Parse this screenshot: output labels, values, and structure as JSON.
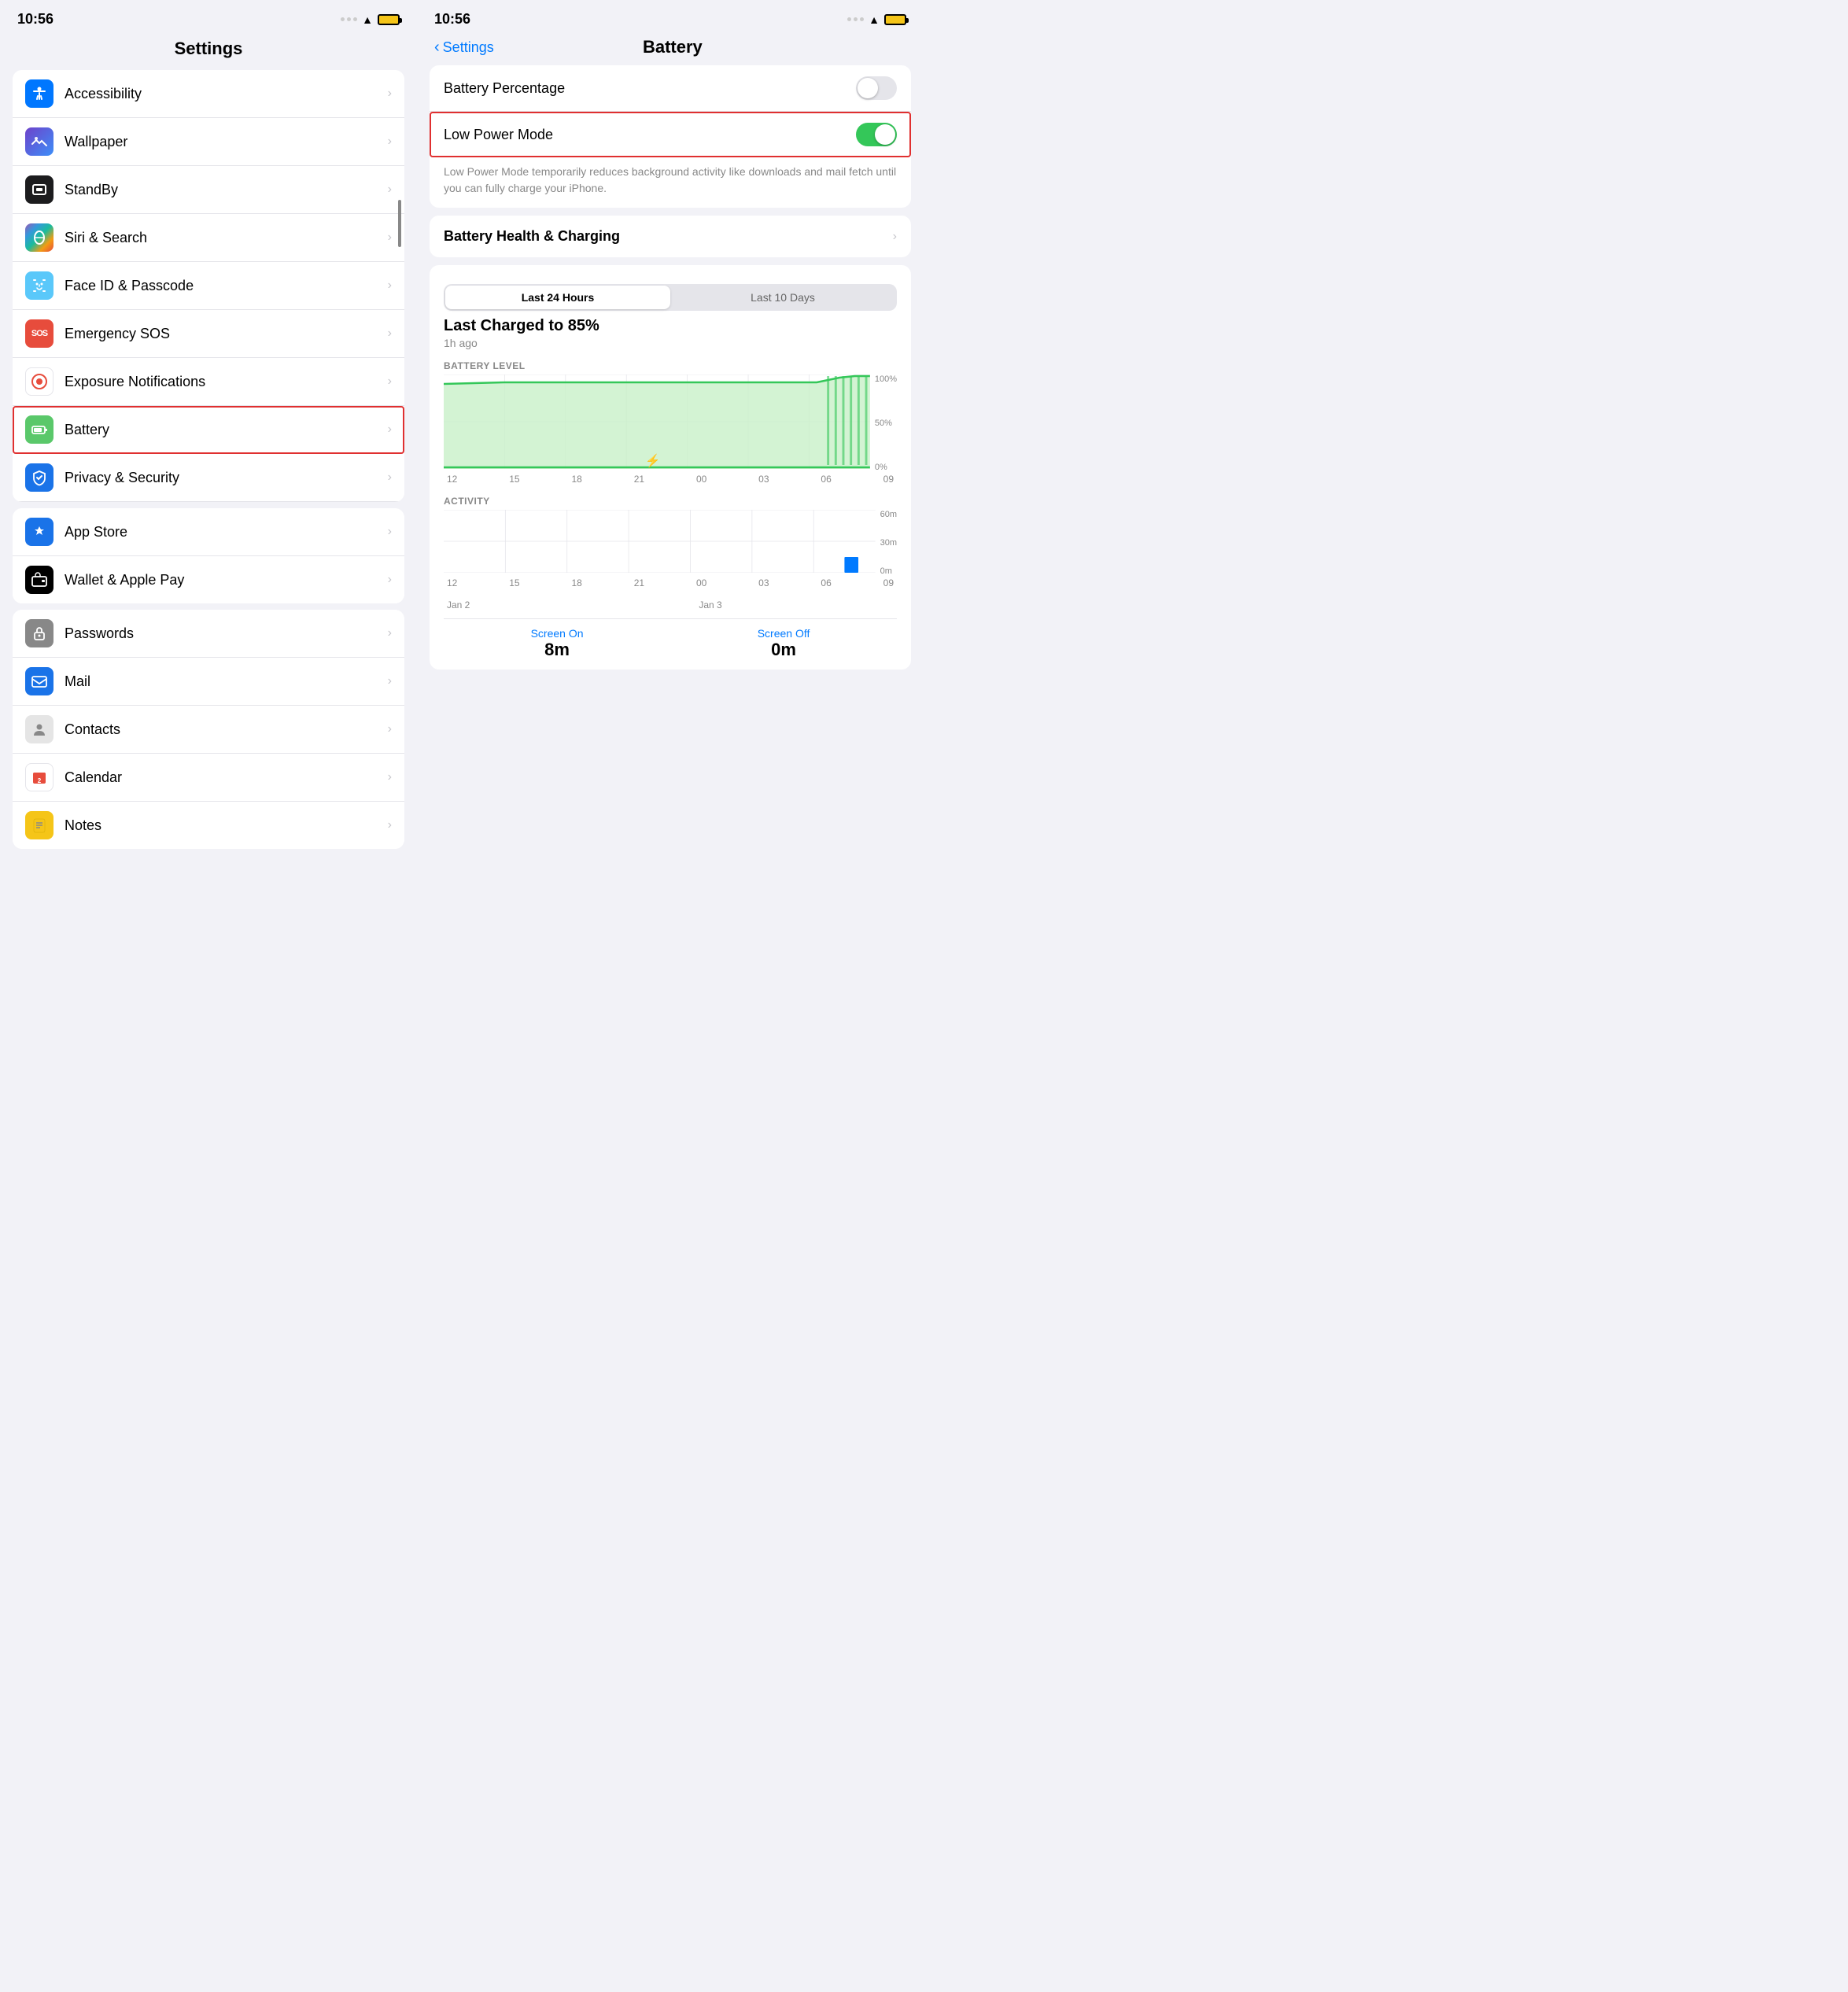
{
  "left": {
    "status": {
      "time": "10:56"
    },
    "title": "Settings",
    "groups": [
      {
        "id": "group1",
        "items": [
          {
            "id": "accessibility",
            "label": "Accessibility",
            "icon": "ic-accessibility",
            "iconChar": "♿",
            "highlighted": false
          },
          {
            "id": "wallpaper",
            "label": "Wallpaper",
            "icon": "ic-wallpaper",
            "iconChar": "❋",
            "highlighted": false
          },
          {
            "id": "standby",
            "label": "StandBy",
            "icon": "ic-standby",
            "iconChar": "⊡",
            "highlighted": false
          },
          {
            "id": "siri",
            "label": "Siri & Search",
            "icon": "ic-siri",
            "iconChar": "◉",
            "highlighted": false
          },
          {
            "id": "faceid",
            "label": "Face ID & Passcode",
            "icon": "ic-faceid",
            "iconChar": "☺",
            "highlighted": false
          },
          {
            "id": "sos",
            "label": "Emergency SOS",
            "icon": "ic-sos",
            "iconChar": "SOS",
            "highlighted": false
          },
          {
            "id": "exposure",
            "label": "Exposure Notifications",
            "icon": "ic-exposure",
            "iconChar": "◎",
            "highlighted": false
          },
          {
            "id": "battery",
            "label": "Battery",
            "icon": "ic-battery",
            "iconChar": "🔋",
            "highlighted": true
          },
          {
            "id": "privacy",
            "label": "Privacy & Security",
            "icon": "ic-privacy",
            "iconChar": "✋",
            "highlighted": false
          }
        ]
      },
      {
        "id": "group2",
        "items": [
          {
            "id": "appstore",
            "label": "App Store",
            "icon": "ic-appstore",
            "iconChar": "A",
            "highlighted": false
          },
          {
            "id": "wallet",
            "label": "Wallet & Apple Pay",
            "icon": "ic-wallet",
            "iconChar": "≡",
            "highlighted": false
          }
        ]
      },
      {
        "id": "group3",
        "items": [
          {
            "id": "passwords",
            "label": "Passwords",
            "icon": "ic-passwords",
            "iconChar": "🔑",
            "highlighted": false
          },
          {
            "id": "mail",
            "label": "Mail",
            "icon": "ic-mail",
            "iconChar": "✉",
            "highlighted": false
          },
          {
            "id": "contacts",
            "label": "Contacts",
            "icon": "ic-contacts",
            "iconChar": "👤",
            "highlighted": false
          },
          {
            "id": "calendar",
            "label": "Calendar",
            "icon": "ic-calendar",
            "iconChar": "📅",
            "highlighted": false
          },
          {
            "id": "notes",
            "label": "Notes",
            "icon": "ic-notes",
            "iconChar": "📝",
            "highlighted": false
          }
        ]
      }
    ]
  },
  "right": {
    "status": {
      "time": "10:56"
    },
    "back_label": "Settings",
    "title": "Battery",
    "battery_percentage_label": "Battery Percentage",
    "low_power_label": "Low Power Mode",
    "low_power_desc": "Low Power Mode temporarily reduces background activity like downloads and mail fetch until you can fully charge your iPhone.",
    "battery_health_label": "Battery Health & Charging",
    "tabs": [
      {
        "id": "24h",
        "label": "Last 24 Hours",
        "active": true
      },
      {
        "id": "10d",
        "label": "Last 10 Days",
        "active": false
      }
    ],
    "last_charged_label": "Last Charged to 85%",
    "last_charged_sub": "1h ago",
    "battery_level_label": "BATTERY LEVEL",
    "battery_percent_100": "100%",
    "battery_percent_50": "50%",
    "battery_percent_0": "0%",
    "x_labels_battery": [
      "12",
      "15",
      "18",
      "21",
      "00",
      "03",
      "06",
      "09"
    ],
    "activity_label": "ACTIVITY",
    "activity_60": "60m",
    "activity_30": "30m",
    "activity_0": "0m",
    "x_labels_activity": [
      "12",
      "15",
      "18",
      "21",
      "00",
      "03",
      "06",
      "09"
    ],
    "date_labels": [
      "Jan 2",
      "",
      "",
      "",
      "Jan 3",
      "",
      "",
      ""
    ],
    "screen_on_label": "Screen On",
    "screen_off_label": "Screen Off",
    "screen_on_value": "8m",
    "screen_off_value": "0m"
  }
}
